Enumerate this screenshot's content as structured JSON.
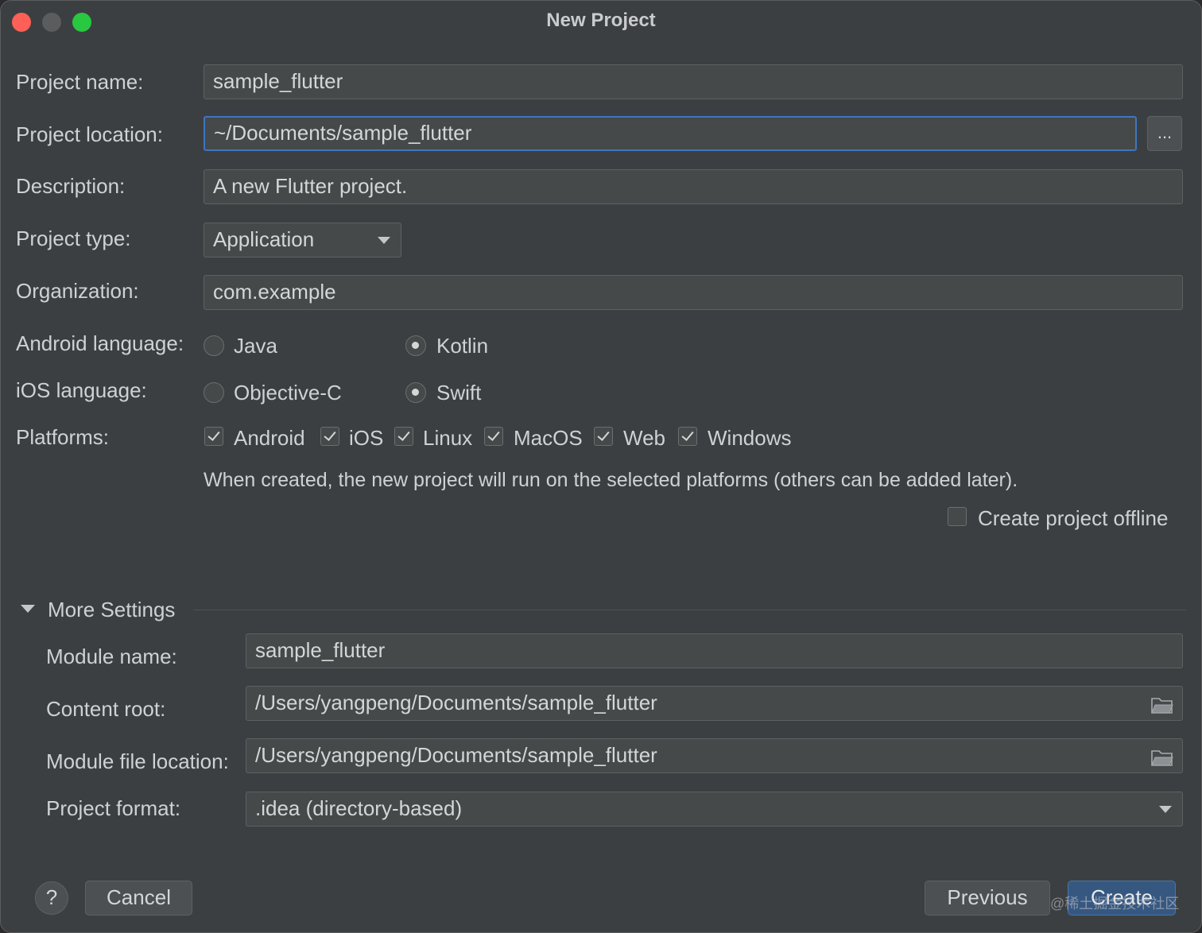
{
  "window": {
    "title": "New Project"
  },
  "form": {
    "project_name": {
      "label": "Project name:",
      "value": "sample_flutter"
    },
    "project_location": {
      "label": "Project location:",
      "value": "~/Documents/sample_flutter",
      "browse": "..."
    },
    "description": {
      "label": "Description:",
      "value": "A new Flutter project."
    },
    "project_type": {
      "label": "Project type:",
      "value": "Application"
    },
    "organization": {
      "label": "Organization:",
      "value": "com.example"
    },
    "android_language": {
      "label": "Android language:",
      "options": [
        "Java",
        "Kotlin"
      ],
      "selected": "Kotlin"
    },
    "ios_language": {
      "label": "iOS language:",
      "options": [
        "Objective-C",
        "Swift"
      ],
      "selected": "Swift"
    },
    "platforms": {
      "label": "Platforms:",
      "items": [
        {
          "name": "Android",
          "checked": true
        },
        {
          "name": "iOS",
          "checked": true
        },
        {
          "name": "Linux",
          "checked": true
        },
        {
          "name": "MacOS",
          "checked": true
        },
        {
          "name": "Web",
          "checked": true
        },
        {
          "name": "Windows",
          "checked": true
        }
      ],
      "hint": "When created, the new project will run on the selected platforms (others can be added later)."
    },
    "offline": {
      "label": "Create project offline",
      "checked": false
    }
  },
  "more_settings": {
    "title": "More Settings",
    "expanded": true,
    "module_name": {
      "label": "Module name:",
      "value": "sample_flutter"
    },
    "content_root": {
      "label": "Content root:",
      "value": "/Users/yangpeng/Documents/sample_flutter"
    },
    "module_file_location": {
      "label": "Module file location:",
      "value": "/Users/yangpeng/Documents/sample_flutter"
    },
    "project_format": {
      "label": "Project format:",
      "value": ".idea (directory-based)"
    }
  },
  "buttons": {
    "help": "?",
    "cancel": "Cancel",
    "previous": "Previous",
    "create": "Create"
  },
  "watermark": "@稀土掘金技术社区",
  "colors": {
    "background": "#3c3f41",
    "focus": "#3d76c0",
    "primary_button": "#365880"
  }
}
